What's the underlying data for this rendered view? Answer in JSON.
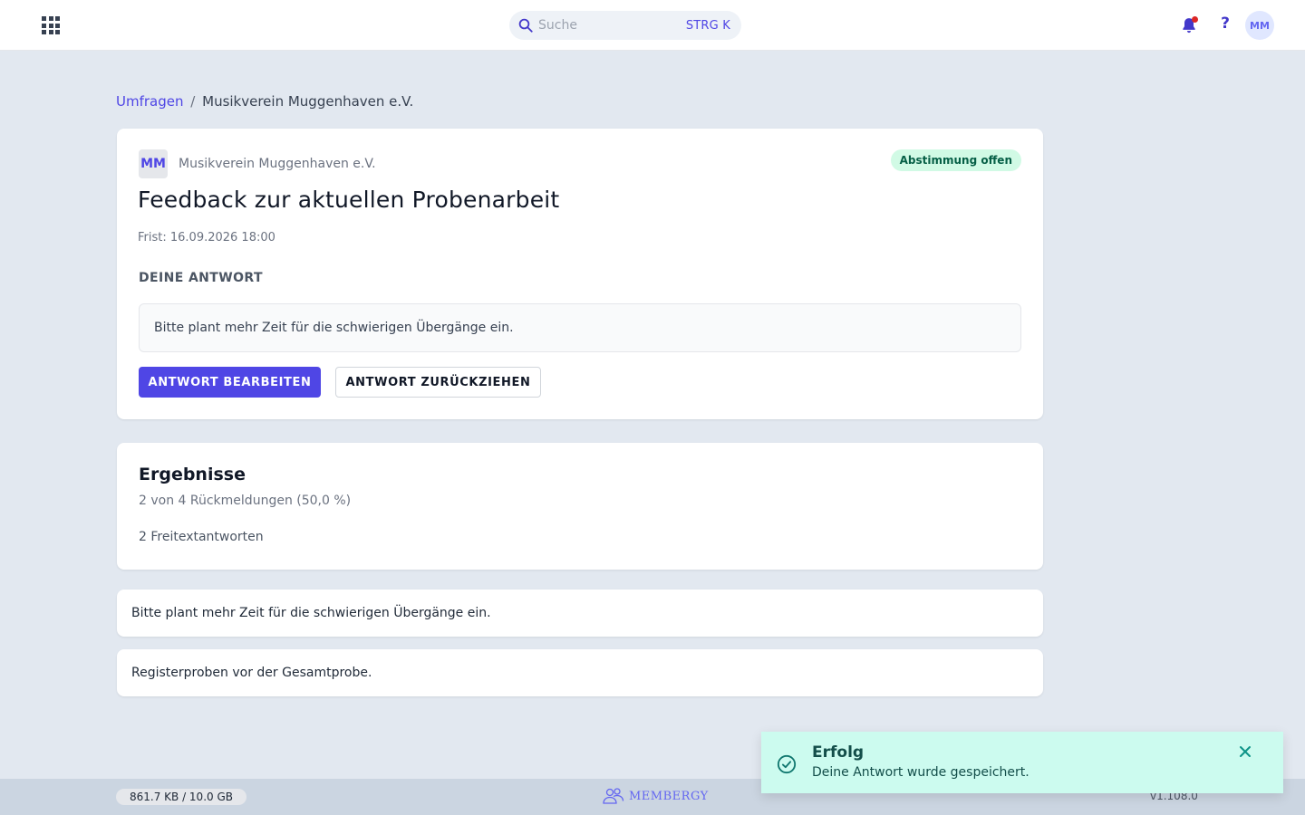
{
  "topbar": {
    "search_placeholder": "Suche",
    "search_shortcut": "STRG K",
    "help_label": "?",
    "avatar_initials": "MM"
  },
  "breadcrumb": {
    "parent": "Umfragen",
    "separator": "/",
    "current": "Musikverein Muggenhaven e.V."
  },
  "survey": {
    "org_initials": "MM",
    "org_name": "Musikverein Muggenhaven e.V.",
    "status": "Abstimmung offen",
    "title": "Feedback zur aktuellen Probenarbeit",
    "deadline": "Frist: 16.09.2026 18:00",
    "answer_section_label": "DEINE ANTWORT",
    "my_answer": "Bitte plant mehr Zeit für die schwierigen Übergänge ein.",
    "edit_button": "ANTWORT BEARBEITEN",
    "withdraw_button": "ANTWORT ZURÜCKZIEHEN"
  },
  "results": {
    "title": "Ergebnisse",
    "stats": "2 von 4 Rückmeldungen (50,0 %)",
    "freetext_count": "2 Freitextantworten",
    "answers": [
      "Bitte plant mehr Zeit für die schwierigen Übergänge ein.",
      "Registerproben vor der Gesamtprobe."
    ]
  },
  "footer": {
    "storage": "861.7 KB / 10.0 GB",
    "brand": "MEMBERGY",
    "version": "v1.108.0"
  },
  "toast": {
    "title": "Erfolg",
    "message": "Deine Antwort wurde gespeichert."
  },
  "colors": {
    "accent": "#4f46e5",
    "background": "#e2e8f0",
    "success_bg": "#ccfbef",
    "status_open_bg": "#d1fae5",
    "notification_dot": "#dc2626"
  }
}
